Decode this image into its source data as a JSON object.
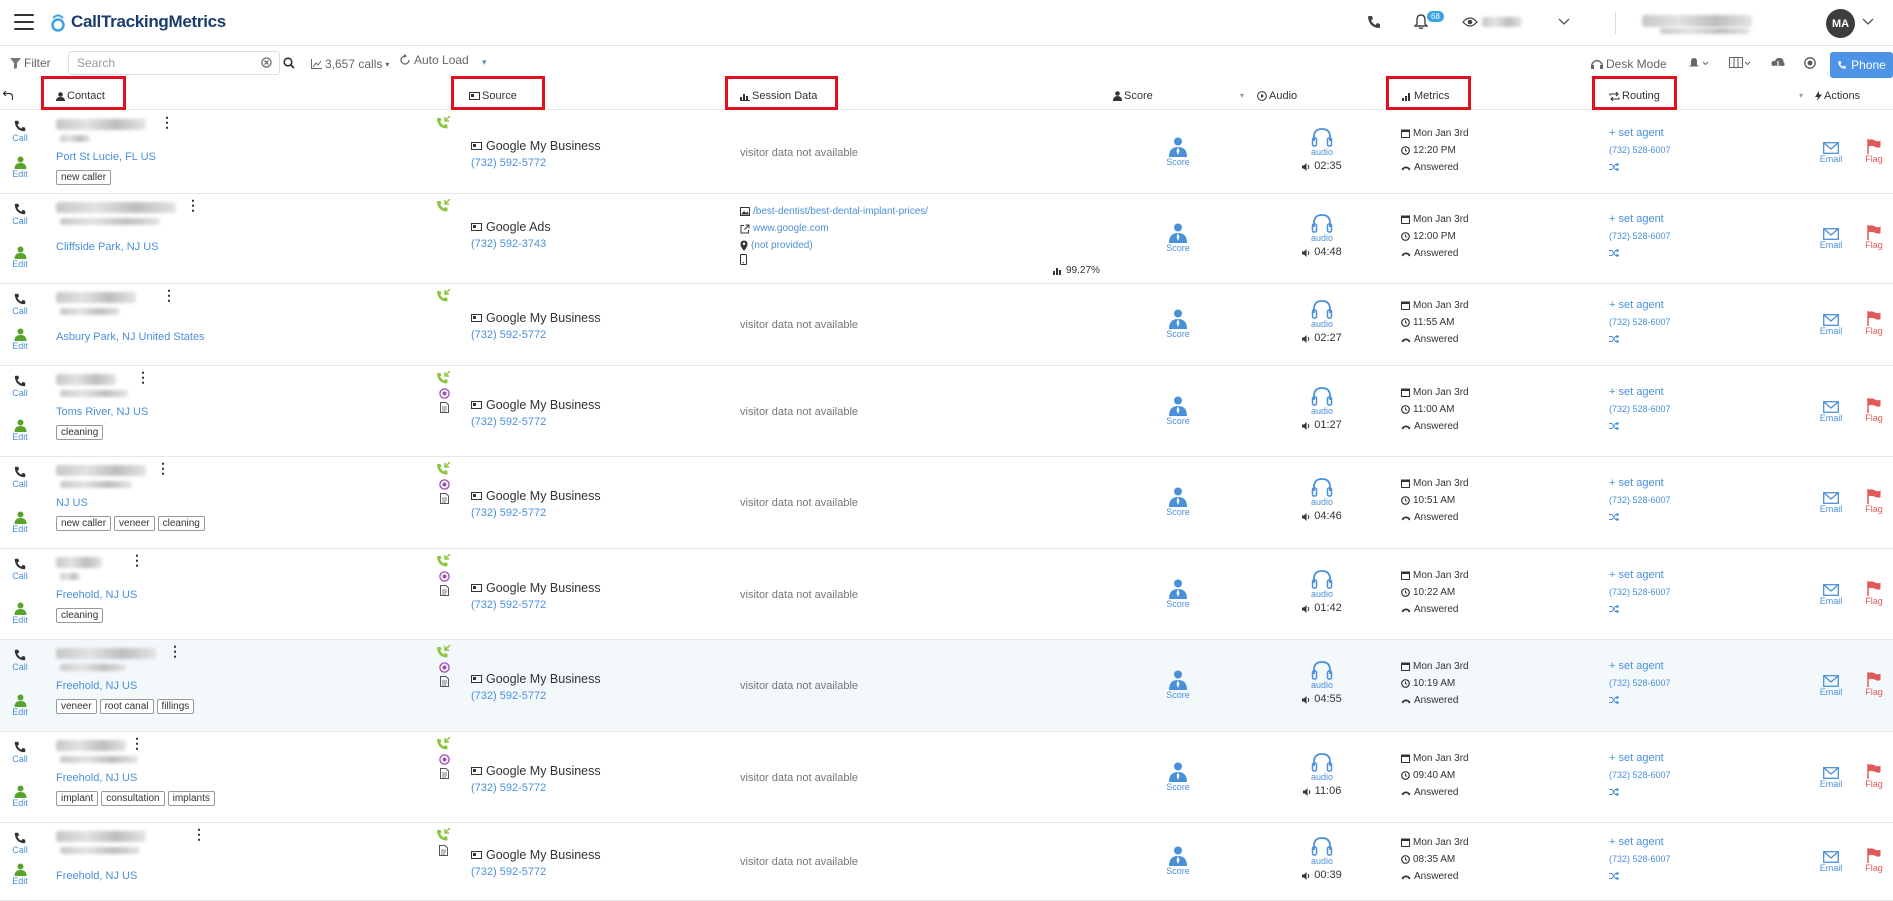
{
  "app": {
    "name": "CallTrackingMetrics",
    "notification_count": "68",
    "avatar_initials": "MA",
    "accent_color": "#4a90d9",
    "highlight_color": "#e0101c"
  },
  "toolbar": {
    "filter_label": "Filter",
    "search_placeholder": "Search",
    "calls_count": "3,657 calls",
    "auto_load_label": "Auto Load",
    "desk_mode_label": "Desk Mode",
    "phone_label": "Phone"
  },
  "columns": {
    "contact": "Contact",
    "source": "Source",
    "session_data": "Session Data",
    "score": "Score",
    "audio": "Audio",
    "metrics": "Metrics",
    "routing": "Routing",
    "actions": "Actions"
  },
  "labels": {
    "call": "Call",
    "edit": "Edit",
    "score": "Score",
    "audio": "audio",
    "email": "Email",
    "flag": "Flag",
    "set_agent": "set agent",
    "visitor_na": "visitor data not available"
  },
  "calls": [
    {
      "location": "Port St Lucie, FL US",
      "tags": [
        "new caller"
      ],
      "source": "Google My Business",
      "tracking_number": "(732) 592-5772",
      "date": "Mon Jan 3rd",
      "time": "12:20 PM",
      "status": "Answered",
      "duration": "02:35",
      "routing_number": "(732) 528-6007",
      "session": null
    },
    {
      "location": "Cliffside Park, NJ US",
      "tags": [],
      "source": "Google Ads",
      "tracking_number": "(732) 592-3743",
      "date": "Mon Jan 3rd",
      "time": "12:00 PM",
      "status": "Answered",
      "duration": "04:48",
      "routing_number": "(732) 528-6007",
      "session": {
        "page": "/best-dentist/best-dental-implant-prices/",
        "referrer": "www.google.com",
        "keyword": "(not provided)",
        "percent": "99.27%"
      }
    },
    {
      "location": "Asbury Park, NJ United States",
      "tags": [],
      "source": "Google My Business",
      "tracking_number": "(732) 592-5772",
      "date": "Mon Jan 3rd",
      "time": "11:55 AM",
      "status": "Answered",
      "duration": "02:27",
      "routing_number": "(732) 528-6007",
      "session": null
    },
    {
      "location": "Toms River, NJ US",
      "tags": [
        "cleaning"
      ],
      "source": "Google My Business",
      "tracking_number": "(732) 592-5772",
      "date": "Mon Jan 3rd",
      "time": "11:00 AM",
      "status": "Answered",
      "duration": "01:27",
      "routing_number": "(732) 528-6007",
      "session": null
    },
    {
      "location": "NJ US",
      "tags": [
        "new caller",
        "veneer",
        "cleaning"
      ],
      "source": "Google My Business",
      "tracking_number": "(732) 592-5772",
      "date": "Mon Jan 3rd",
      "time": "10:51 AM",
      "status": "Answered",
      "duration": "04:46",
      "routing_number": "(732) 528-6007",
      "session": null
    },
    {
      "location": "Freehold, NJ US",
      "tags": [
        "cleaning"
      ],
      "source": "Google My Business",
      "tracking_number": "(732) 592-5772",
      "date": "Mon Jan 3rd",
      "time": "10:22 AM",
      "status": "Answered",
      "duration": "01:42",
      "routing_number": "(732) 528-6007",
      "session": null
    },
    {
      "location": "Freehold, NJ US",
      "tags": [
        "veneer",
        "root canal",
        "fillings"
      ],
      "source": "Google My Business",
      "tracking_number": "(732) 592-5772",
      "date": "Mon Jan 3rd",
      "time": "10:19 AM",
      "status": "Answered",
      "duration": "04:55",
      "routing_number": "(732) 528-6007",
      "session": null
    },
    {
      "location": "Freehold, NJ US",
      "tags": [
        "implant",
        "consultation",
        "implants"
      ],
      "source": "Google My Business",
      "tracking_number": "(732) 592-5772",
      "date": "Mon Jan 3rd",
      "time": "09:40 AM",
      "status": "Answered",
      "duration": "11:06",
      "routing_number": "(732) 528-6007",
      "session": null
    },
    {
      "location": "Freehold, NJ US",
      "tags": [],
      "source": "Google My Business",
      "tracking_number": "(732) 592-5772",
      "date": "Mon Jan 3rd",
      "time": "08:35 AM",
      "status": "Answered",
      "duration": "00:39",
      "routing_number": "(732) 528-6007",
      "session": null
    }
  ]
}
